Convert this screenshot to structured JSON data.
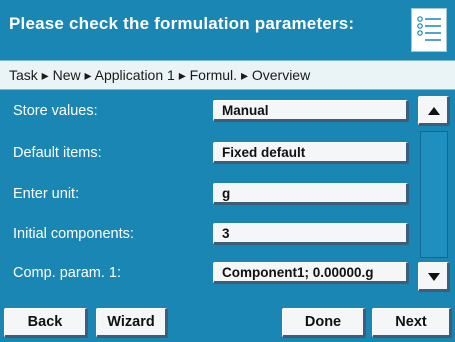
{
  "header": {
    "title": "Please check the formulation parameters:",
    "menu_icon": "list-menu-icon"
  },
  "breadcrumb": "Task ▸ New ▸ Application 1 ▸ Formul. ▸ Overview",
  "rows": [
    {
      "label": "Store values:",
      "value": "Manual"
    },
    {
      "label": "Default items:",
      "value": "Fixed default"
    },
    {
      "label": "Enter unit:",
      "value": "g"
    },
    {
      "label": "Initial components:",
      "value": "3"
    },
    {
      "label": "Comp. param. 1:",
      "value": "Component1; 0.00000.g"
    }
  ],
  "scrollbar": {
    "up_icon": "scroll-up-arrow-icon",
    "down_icon": "scroll-down-arrow-icon"
  },
  "footer": {
    "back": "Back",
    "wizard": "Wizard",
    "done": "Done",
    "next": "Next"
  },
  "colors": {
    "accent": "#1a86b4",
    "breadcrumb_bg": "#eaf3f6",
    "button_face": "#f4f6f8",
    "button_shadow": "#3e5d78"
  }
}
